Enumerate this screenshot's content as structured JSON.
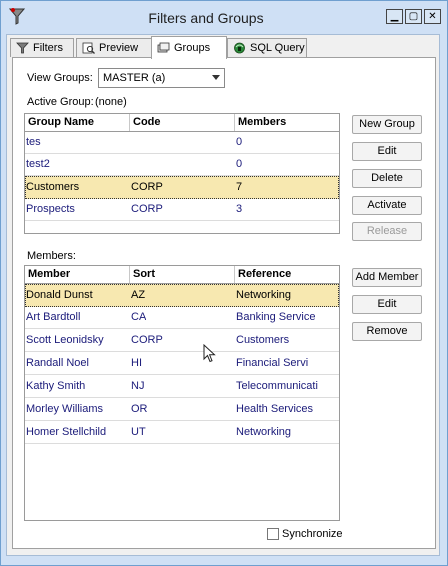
{
  "window": {
    "title": "Filters and Groups",
    "min_glyph": "▁",
    "max_glyph": "▢",
    "close_glyph": "✕"
  },
  "tabs": [
    {
      "label": "Filters",
      "icon": "filter-icon",
      "active": false
    },
    {
      "label": "Preview",
      "icon": "preview-icon",
      "active": false
    },
    {
      "label": "Groups",
      "icon": "groups-icon",
      "active": true
    },
    {
      "label": "SQL Query",
      "icon": "sql-query-icon",
      "active": false
    }
  ],
  "view_groups": {
    "label": "View Groups:",
    "value": "MASTER (a)"
  },
  "active_group": {
    "label": "Active Group:",
    "value": "(none)"
  },
  "groups_table": {
    "columns": [
      "Group Name",
      "Code",
      "Members"
    ],
    "rows": [
      {
        "name": "tes",
        "code": "",
        "members": "0"
      },
      {
        "name": "test2",
        "code": "",
        "members": "0"
      },
      {
        "name": "Customers",
        "code": "CORP",
        "members": "7",
        "selected": true
      },
      {
        "name": "Prospects",
        "code": "CORP",
        "members": "3"
      }
    ]
  },
  "group_buttons": {
    "new_group": "New Group",
    "edit": "Edit",
    "delete": "Delete",
    "activate": "Activate",
    "release": "Release"
  },
  "members_label": "Members:",
  "members_table": {
    "columns": [
      "Member",
      "Sort",
      "Reference"
    ],
    "rows": [
      {
        "member": "Donald Dunst",
        "sort": "AZ",
        "reference": "Networking",
        "selected": true
      },
      {
        "member": "Art Bardtoll",
        "sort": "CA",
        "reference": "Banking Service"
      },
      {
        "member": "Scott Leonidsky",
        "sort": "CORP",
        "reference": "Customers"
      },
      {
        "member": "Randall Noel",
        "sort": "HI",
        "reference": "Financial Servi"
      },
      {
        "member": "Kathy Smith",
        "sort": "NJ",
        "reference": "Telecommunicati"
      },
      {
        "member": "Morley Williams",
        "sort": "OR",
        "reference": "Health Services"
      },
      {
        "member": "Homer Stellchild",
        "sort": "UT",
        "reference": "Networking"
      }
    ]
  },
  "member_buttons": {
    "add_member": "Add Member",
    "edit": "Edit",
    "remove": "Remove"
  },
  "synchronize": {
    "label": "Synchronize",
    "checked": false
  }
}
